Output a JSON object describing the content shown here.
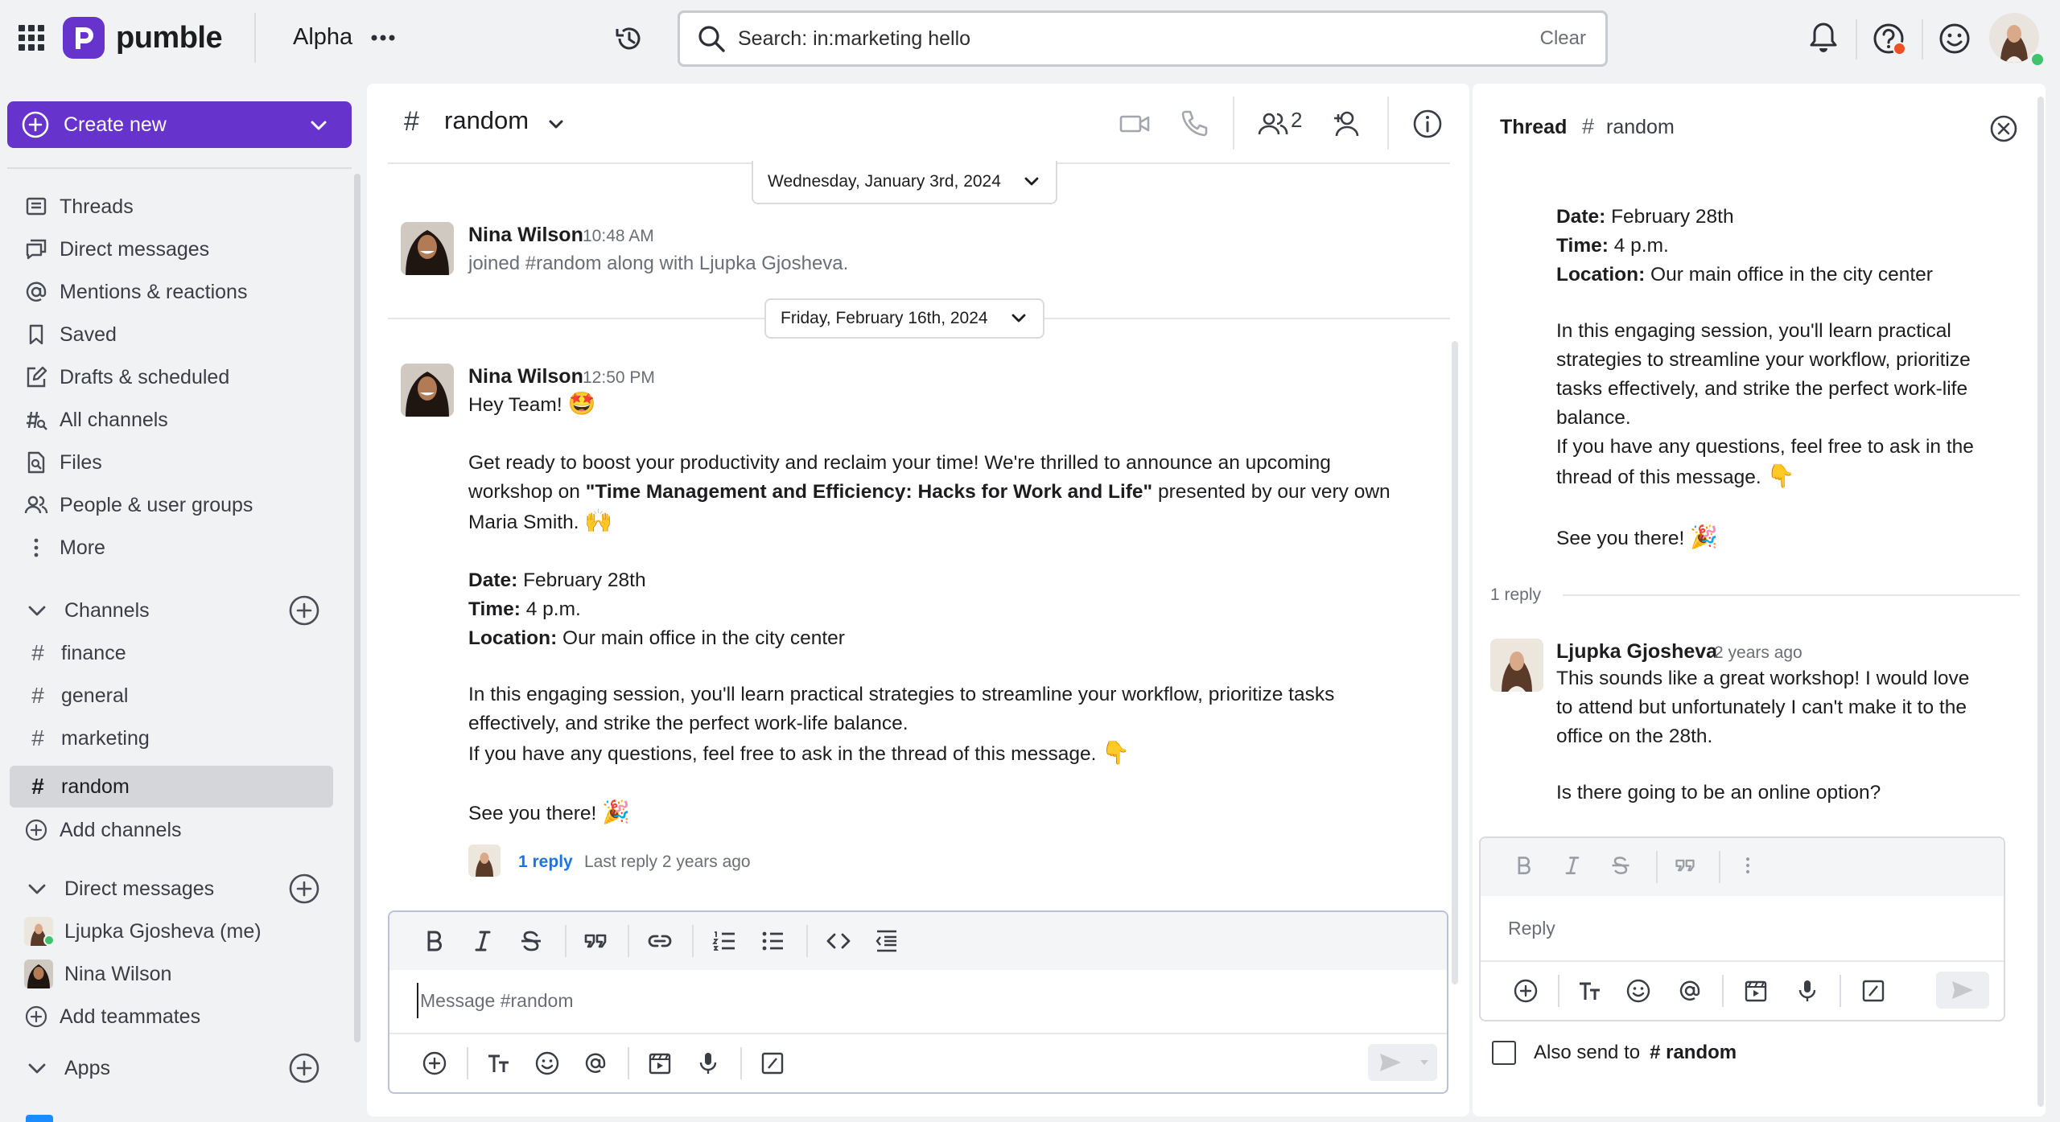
{
  "app": {
    "brand": "pumble",
    "workspace": "Alpha"
  },
  "colors": {
    "accent": "#6633cc",
    "link": "#1a73e8",
    "online": "#3ec46d",
    "alert": "#f04e23"
  },
  "search": {
    "value": "Search: in:marketing hello",
    "clear_label": "Clear"
  },
  "sidebar": {
    "create_label": "Create new",
    "nav": [
      "Threads",
      "Direct messages",
      "Mentions & reactions",
      "Saved",
      "Drafts & scheduled",
      "All channels",
      "Files",
      "People & user groups",
      "More"
    ],
    "channels_header": "Channels",
    "channels": [
      "finance",
      "general",
      "marketing",
      "random"
    ],
    "active_channel": "random",
    "add_channels": "Add channels",
    "dm_header": "Direct messages",
    "dms": [
      "Ljupka Gjosheva (me)",
      "Nina Wilson"
    ],
    "add_teammates": "Add teammates",
    "apps_header": "Apps"
  },
  "channel": {
    "name": "random",
    "member_count": "2",
    "date_1": "Wednesday, January 3rd, 2024",
    "date_2": "Friday, February 16th, 2024",
    "messages": [
      {
        "author": "Nina Wilson",
        "time": "10:48 AM",
        "text": "joined #random along with Ljupka Gjosheva."
      },
      {
        "author": "Nina Wilson",
        "time": "12:50 PM",
        "greeting": "Hey Team!",
        "greeting_emoji": "🤩",
        "intro_1": "Get ready to boost your productivity and reclaim your time! We're thrilled to announce an upcoming",
        "intro_2_pre": "workshop on ",
        "workshop_title": "\"Time Management and Efficiency: Hacks for Work and Life\"",
        "intro_2_post": " presented by our very own",
        "intro_3": "Maria Smith.",
        "intro_emoji": "🙌",
        "date_label": "Date:",
        "date_value": " February 28th",
        "time_label": "Time:",
        "time_value": " 4 p.m.",
        "location_label": "Location:",
        "location_value": " Our main office in the city center",
        "body_1": "In this engaging session, you'll learn practical strategies to streamline your workflow, prioritize tasks",
        "body_2": "effectively, and strike the perfect work-life balance.",
        "body_3": "If you have any questions, feel free to ask in the thread of this message.",
        "body_emoji": "👇",
        "closing": "See you there!",
        "closing_emoji": "🎉",
        "reply_link": "1 reply",
        "last_reply": "Last reply 2 years ago"
      }
    ],
    "composer_placeholder": "Message #random"
  },
  "thread": {
    "title": "Thread",
    "channel": "random",
    "parent": {
      "date_label": "Date:",
      "date_value": " February 28th",
      "time_label": "Time:",
      "time_value": " 4 p.m.",
      "location_label": "Location:",
      "location_value": " Our main office in the city center",
      "body_1": "In this engaging session, you'll learn practical",
      "body_2": "strategies to streamline your workflow, prioritize",
      "body_3": "tasks effectively, and strike the perfect work-life",
      "body_4": "balance.",
      "body_5": "If you have any questions, feel free to ask in the",
      "body_6": "thread of this message.",
      "body_emoji": "👇",
      "closing": "See you there!",
      "closing_emoji": "🎉"
    },
    "reply_count": "1 reply",
    "reply": {
      "author": "Ljupka Gjosheva",
      "time": "2 years ago",
      "line_1": "This sounds like a great workshop! I would love",
      "line_2": "to attend but unfortunately I can't make it to the",
      "line_3": "office on  the 28th.",
      "line_4": "Is there going to be an online option?"
    },
    "reply_placeholder": "Reply",
    "also_send_label": "Also send to",
    "also_send_channel": "# random"
  }
}
